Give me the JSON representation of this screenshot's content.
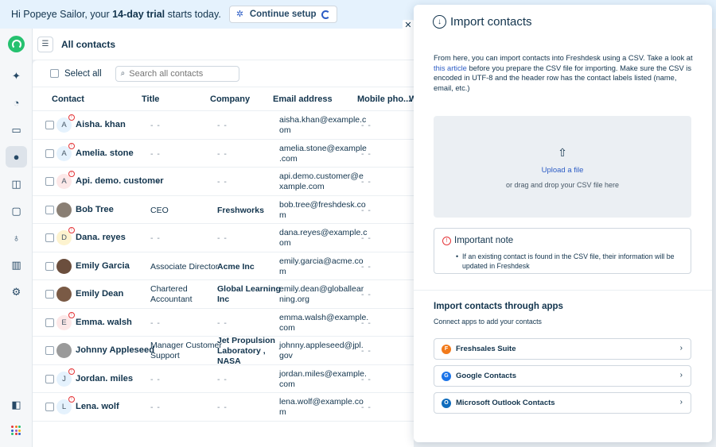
{
  "banner": {
    "greeting": "Hi Popeye Sailor, your ",
    "trial": "14-day trial",
    "suffix": " starts today.",
    "setup_label": "Continue setup"
  },
  "header": {
    "title": "All contacts"
  },
  "toolbar": {
    "select_all": "Select all",
    "search_placeholder": "Search all contacts"
  },
  "columns": [
    "Contact",
    "Title",
    "Company",
    "Email address",
    "Mobile pho...",
    "W"
  ],
  "contacts": [
    {
      "initial": "A",
      "name": "Aisha. khan",
      "title": "- -",
      "company": "- -",
      "email1": "aisha.khan@example.c",
      "email2": "om",
      "mobile": "- -",
      "avatar_bg": "#e5f2fd",
      "warn": true
    },
    {
      "initial": "A",
      "name": "Amelia. stone",
      "title": "- -",
      "company": "- -",
      "email1": "amelia.stone@example",
      "email2": ".com",
      "mobile": "- -",
      "avatar_bg": "#e5f2fd",
      "warn": true
    },
    {
      "initial": "A",
      "name": "Api. demo. customer",
      "title": "- -",
      "company": "- -",
      "email1": "api.demo.customer@e",
      "email2": "xample.com",
      "mobile": "- -",
      "avatar_bg": "#fde8e8",
      "warn": true
    },
    {
      "initial": "",
      "name": "Bob Tree",
      "title": "CEO",
      "company": "Freshworks",
      "email1": "bob.tree@freshdesk.co",
      "email2": "m",
      "mobile": "- -",
      "avatar_bg": "#8a7f74",
      "warn": false,
      "photo": true
    },
    {
      "initial": "D",
      "name": "Dana. reyes",
      "title": "- -",
      "company": "- -",
      "email1": "dana.reyes@example.c",
      "email2": "om",
      "mobile": "- -",
      "avatar_bg": "#fdf3cf",
      "warn": true
    },
    {
      "initial": "",
      "name": "Emily Garcia",
      "title": "Associate Director",
      "company": "Acme Inc",
      "email1": "emily.garcia@acme.co",
      "email2": "m",
      "mobile": "- -",
      "avatar_bg": "#6b4e3d",
      "warn": false,
      "photo": true
    },
    {
      "initial": "",
      "name": "Emily Dean",
      "title": "Chartered",
      "title2": "Accountant",
      "company": "Global Learning",
      "company2": "Inc",
      "email1": "emily.dean@globallear",
      "email2": "ning.org",
      "mobile": "- -",
      "avatar_bg": "#7a5a45",
      "warn": false,
      "photo": true
    },
    {
      "initial": "E",
      "name": "Emma. walsh",
      "title": "- -",
      "company": "- -",
      "email1": "emma.walsh@example.",
      "email2": "com",
      "mobile": "- -",
      "avatar_bg": "#fde8e8",
      "warn": true
    },
    {
      "initial": "",
      "name": "Johnny Appleseed",
      "title": "Manager Customer",
      "title2": "Support",
      "company": "Jet Propulsion",
      "company2": "Laboratory ,",
      "company3": "NASA",
      "email1": "johnny.appleseed@jpl.",
      "email2": "gov",
      "mobile": "- -",
      "avatar_bg": "#9a9a9a",
      "warn": false,
      "photo": true
    },
    {
      "initial": "J",
      "name": "Jordan. miles",
      "title": "- -",
      "company": "- -",
      "email1": "jordan.miles@example.",
      "email2": "com",
      "mobile": "- -",
      "avatar_bg": "#e5f2fd",
      "warn": true
    },
    {
      "initial": "L",
      "name": "Lena. wolf",
      "title": "- -",
      "company": "- -",
      "email1": "lena.wolf@example.co",
      "email2": "m",
      "mobile": "- -",
      "avatar_bg": "#e5f2fd",
      "warn": true
    }
  ],
  "panel": {
    "title": "Import contacts",
    "desc_a": "From here, you can import contacts into Freshdesk using a CSV. Take a look at ",
    "desc_link": "this article",
    "desc_b": " before you prepare the CSV file for importing. Make sure the CSV is encoded in UTF-8 and the header row has the contact labels listed (name, email, etc.)",
    "upload_label": "Upload a file",
    "drop_label": "or drag and drop your CSV file here",
    "note_title": "Important note",
    "note_body": "If an existing contact is found in the CSV file, their information will be updated in Freshdesk",
    "apps_title": "Import contacts through apps",
    "apps_sub": "Connect apps to add your contacts",
    "apps": [
      {
        "name": "Freshsales Suite",
        "icon_color": "#f27a1a",
        "glyph": "F"
      },
      {
        "name": "Google Contacts",
        "icon_color": "#1a73e8",
        "glyph": "G"
      },
      {
        "name": "Microsoft Outlook Contacts",
        "icon_color": "#0f6cbd",
        "glyph": "O"
      }
    ]
  }
}
